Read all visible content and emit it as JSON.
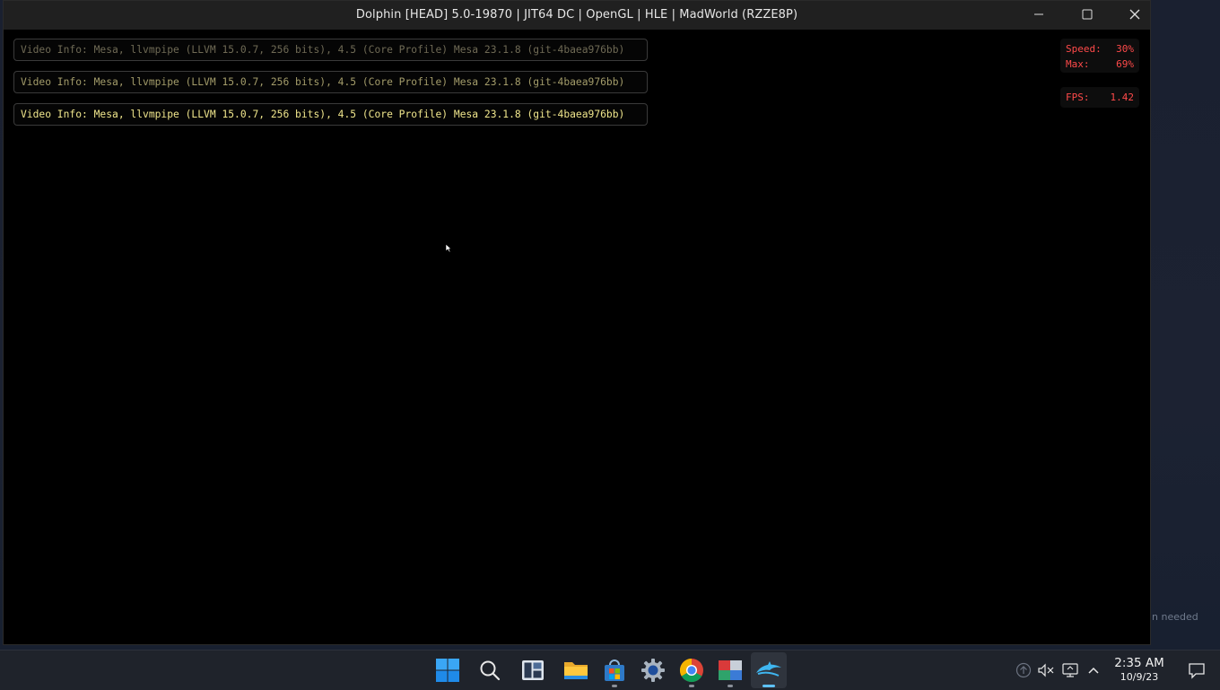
{
  "window": {
    "title": "Dolphin [HEAD] 5.0-19870 | JIT64 DC | OpenGL | HLE | MadWorld (RZZE8P)"
  },
  "osd_messages": [
    "Video Info: Mesa, llvmpipe (LLVM 15.0.7, 256 bits), 4.5 (Core Profile) Mesa 23.1.8 (git-4baea976bb)",
    "Video Info: Mesa, llvmpipe (LLVM 15.0.7, 256 bits), 4.5 (Core Profile) Mesa 23.1.8 (git-4baea976bb)",
    "Video Info: Mesa, llvmpipe (LLVM 15.0.7, 256 bits), 4.5 (Core Profile) Mesa 23.1.8 (git-4baea976bb)"
  ],
  "stats": {
    "speed_label": "Speed:",
    "speed_value": "30%",
    "max_label": "Max:",
    "max_value": "69%",
    "fps_label": "FPS:",
    "fps_value": "1.42"
  },
  "desktop": {
    "partial_text": "n needed"
  },
  "taskbar": {
    "apps": [
      {
        "name": "start-button",
        "icon": "windows-logo-icon"
      },
      {
        "name": "search-button",
        "icon": "search-icon"
      },
      {
        "name": "widgets-button",
        "icon": "widgets-icon"
      },
      {
        "name": "file-explorer-button",
        "icon": "folder-icon"
      },
      {
        "name": "store-button",
        "icon": "store-icon"
      },
      {
        "name": "settings-button",
        "icon": "gear-icon"
      },
      {
        "name": "chrome-button",
        "icon": "chrome-icon"
      },
      {
        "name": "app-button",
        "icon": "app-icon"
      },
      {
        "name": "dolphin-button",
        "icon": "dolphin-icon"
      }
    ],
    "clock": {
      "time": "2:35 AM",
      "date": "10/9/23"
    }
  },
  "colors": {
    "osd_text": "#f0e68c",
    "stats_text": "#ff4a4a",
    "taskbar_bg": "#1f232b",
    "accent": "#5ec2ff"
  }
}
